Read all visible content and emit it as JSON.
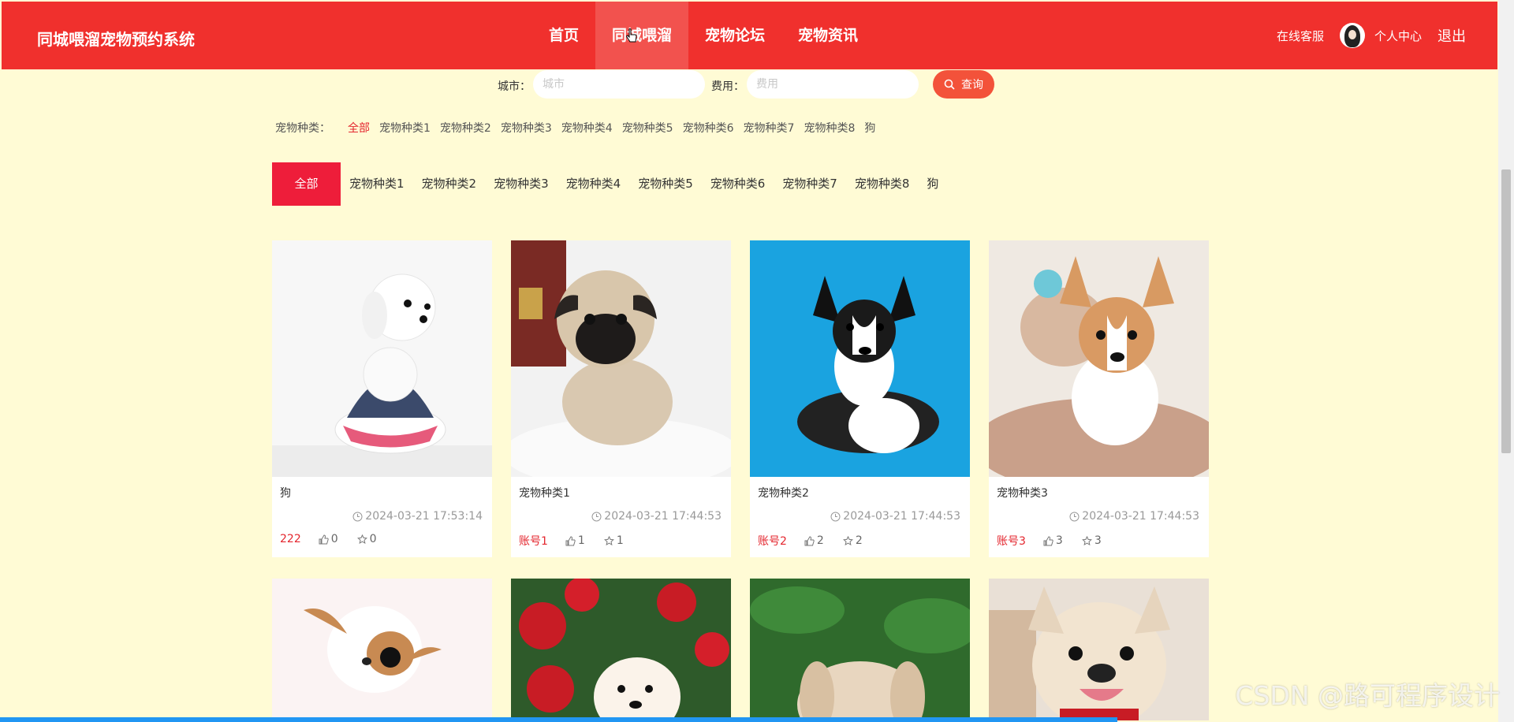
{
  "header": {
    "brand": "同城喂溜宠物预约系统",
    "nav": [
      "首页",
      "同城喂溜",
      "宠物论坛",
      "宠物资讯"
    ],
    "active_nav": 1,
    "right": {
      "service": "在线客服",
      "profile": "个人中心",
      "logout": "退出"
    }
  },
  "search": {
    "city_label": "城市：",
    "city_placeholder": "城市",
    "fee_label": "费用：",
    "fee_placeholder": "费用",
    "button": "查询"
  },
  "categories": {
    "label": "宠物种类：",
    "items": [
      "全部",
      "宠物种类1",
      "宠物种类2",
      "宠物种类3",
      "宠物种类4",
      "宠物种类5",
      "宠物种类6",
      "宠物种类7",
      "宠物种类8",
      "狗"
    ]
  },
  "tabs": [
    "全部",
    "宠物种类1",
    "宠物种类2",
    "宠物种类3",
    "宠物种类4",
    "宠物种类5",
    "宠物种类6",
    "宠物种类7",
    "宠物种类8",
    "狗"
  ],
  "cards": [
    {
      "title": "狗",
      "time": "2024-03-21 17:53:14",
      "user": "222",
      "likes": "0",
      "favs": "0"
    },
    {
      "title": "宠物种类1",
      "time": "2024-03-21 17:44:53",
      "user": "账号1",
      "likes": "1",
      "favs": "1"
    },
    {
      "title": "宠物种类2",
      "time": "2024-03-21 17:44:53",
      "user": "账号2",
      "likes": "2",
      "favs": "2"
    },
    {
      "title": "宠物种类3",
      "time": "2024-03-21 17:44:53",
      "user": "账号3",
      "likes": "3",
      "favs": "3"
    }
  ],
  "watermark": "CSDN @路可程序设计",
  "colors": {
    "header": "#f0302d",
    "accent": "#e4262e",
    "background": "#fffbd5",
    "tab_active": "#ee1d3a"
  }
}
